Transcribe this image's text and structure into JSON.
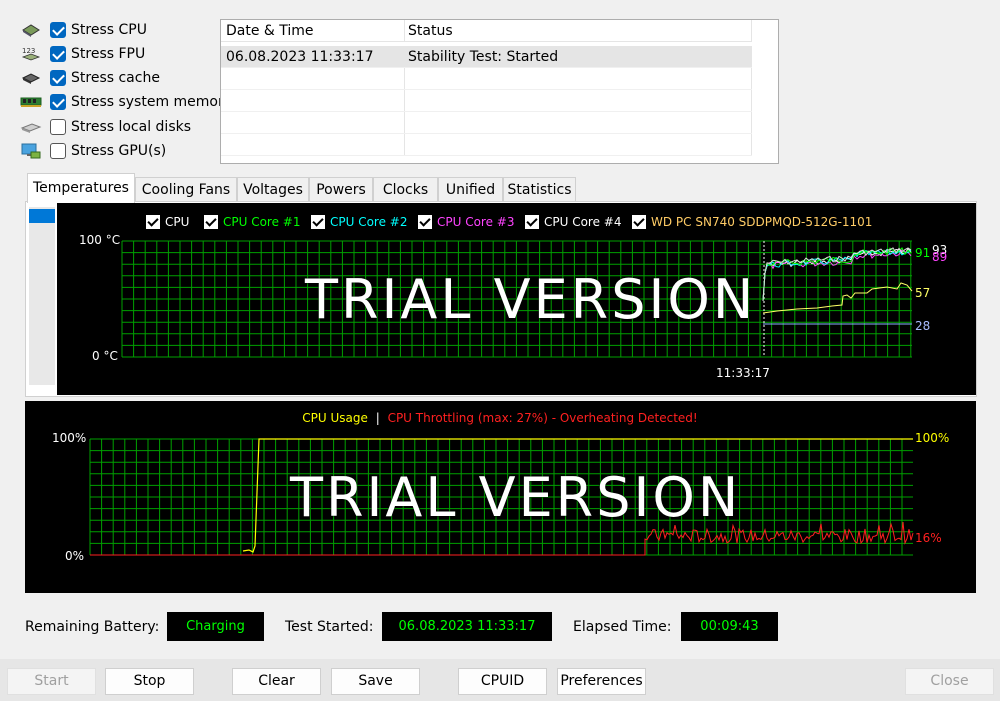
{
  "stress_options": [
    {
      "label": "Stress CPU",
      "checked": true,
      "icon": "cpu-chip-icon"
    },
    {
      "label": "Stress FPU",
      "checked": true,
      "icon": "fpu-numbers-icon"
    },
    {
      "label": "Stress cache",
      "checked": true,
      "icon": "cache-chip-icon"
    },
    {
      "label": "Stress system memory",
      "checked": true,
      "icon": "memory-module-icon"
    },
    {
      "label": "Stress local disks",
      "checked": false,
      "icon": "disk-drive-icon"
    },
    {
      "label": "Stress GPU(s)",
      "checked": false,
      "icon": "monitor-icon"
    }
  ],
  "log": {
    "headers": [
      "Date & Time",
      "Status"
    ],
    "rows": [
      {
        "datetime": "06.08.2023 11:33:17",
        "status": "Stability Test: Started"
      }
    ]
  },
  "tabs": [
    "Temperatures",
    "Cooling Fans",
    "Voltages",
    "Powers",
    "Clocks",
    "Unified",
    "Statistics"
  ],
  "active_tab": "Temperatures",
  "temp_graph": {
    "legend": [
      {
        "label": "CPU",
        "color": "#ffffff"
      },
      {
        "label": "CPU Core #1",
        "color": "#00ff00"
      },
      {
        "label": "CPU Core #2",
        "color": "#00ffff"
      },
      {
        "label": "CPU Core #3",
        "color": "#ff44ff"
      },
      {
        "label": "CPU Core #4",
        "color": "#ffffff"
      },
      {
        "label": "WD PC SN740 SDDPMQD-512G-1101",
        "color": "#ffcc66"
      }
    ],
    "y_max_label": "100 °C",
    "y_min_label": "0 °C",
    "time_label": "11:33:17",
    "value_labels": {
      "v93": "93",
      "v91": "91",
      "v89": "89",
      "v57": "57",
      "v28": "28"
    },
    "watermark": "TRIAL VERSION"
  },
  "usage_graph": {
    "title_usage": "CPU Usage",
    "separator": "|",
    "title_throttle": "CPU Throttling (max: 27%) - Overheating Detected!",
    "y_max_label": "100%",
    "y_min_label": "0%",
    "usage_value": "100%",
    "throttle_value": "16%",
    "watermark": "TRIAL VERSION"
  },
  "status": {
    "battery_label": "Remaining Battery:",
    "battery_value": "Charging",
    "started_label": "Test Started:",
    "started_value": "06.08.2023 11:33:17",
    "elapsed_label": "Elapsed Time:",
    "elapsed_value": "00:09:43"
  },
  "buttons": {
    "start": "Start",
    "stop": "Stop",
    "clear": "Clear",
    "save": "Save",
    "cpuid": "CPUID",
    "preferences": "Preferences",
    "close": "Close"
  },
  "colors": {
    "grid": "#00a000",
    "cpu_usage": "#ffff00",
    "throttle": "#ff0000",
    "disk_temp": "#ffff66",
    "status_text": "#00ff00"
  }
}
